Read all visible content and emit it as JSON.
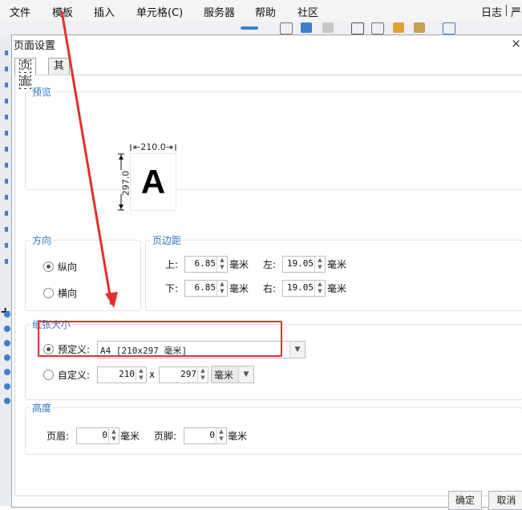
{
  "menubar": {
    "items": [
      "文件",
      "模板",
      "插入",
      "单元格(C)",
      "服务器",
      "帮助",
      "社区"
    ],
    "right": "日志",
    "right_cut": "严"
  },
  "dialog": {
    "title": "页面设置",
    "close": "×",
    "tabs": [
      "页面",
      "其他"
    ],
    "preview": {
      "title": "预览",
      "width_label": "210.0",
      "height_label": "297.0",
      "letter": "A"
    },
    "orientation": {
      "title": "方向",
      "portrait": "纵向",
      "landscape": "横向",
      "selected": "portrait"
    },
    "margins": {
      "title": "页边距",
      "top_label": "上:",
      "top_value": "6.85",
      "left_label": "左:",
      "left_value": "19.05",
      "bottom_label": "下:",
      "bottom_value": "6.85",
      "right_label": "右:",
      "right_value": "19.05",
      "unit": "毫米"
    },
    "paper_size": {
      "title": "纸张大小",
      "preset_label": "预定义:",
      "preset_value": "A4 [210x297 毫米]",
      "custom_label": "自定义:",
      "custom_width": "210",
      "times": "x",
      "custom_height": "297",
      "custom_unit": "毫米",
      "selected": "preset"
    },
    "height": {
      "title": "高度",
      "header_label": "页眉:",
      "header_value": "0",
      "footer_label": "页脚:",
      "footer_value": "0",
      "unit": "毫米"
    },
    "buttons": {
      "ok": "确定",
      "cancel": "取消"
    }
  },
  "colors": {
    "accent": "#2f76bd",
    "annotation": "#e03030"
  }
}
